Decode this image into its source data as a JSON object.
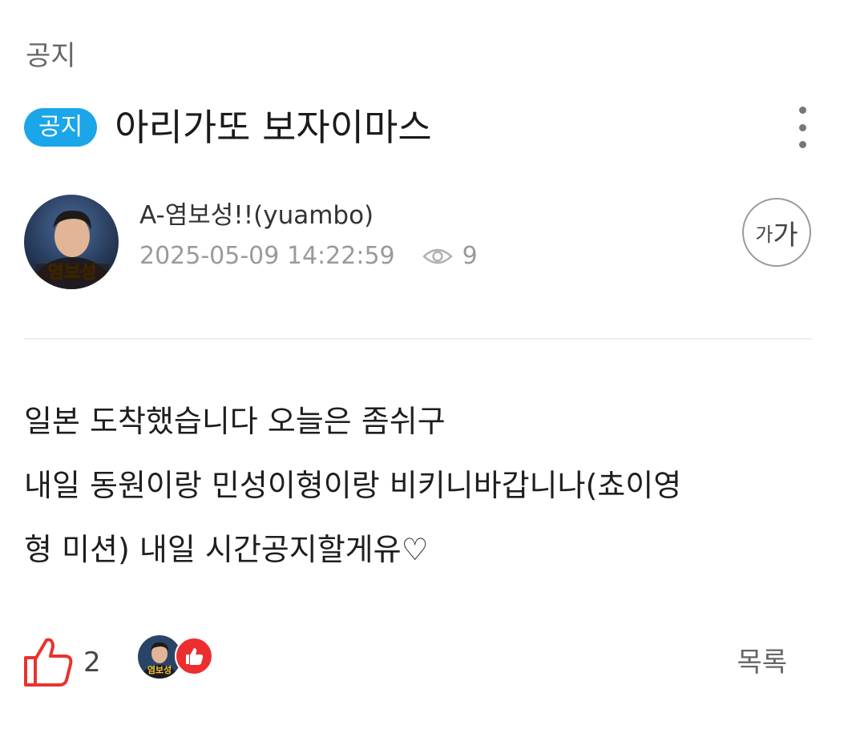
{
  "board": {
    "category": "공지"
  },
  "post": {
    "badge": "공지",
    "title": "아리가또 보자이마스",
    "author": "A-염보성!!(yuambo)",
    "avatar_text": "염보성",
    "datetime": "2025-05-09 14:22:59",
    "views": "9",
    "font_size_small": "가",
    "font_size_big": "가",
    "body_lines": [
      "일본 도착했습니다 오늘은 좀쉬구",
      "내일 동원이랑 민성이형이랑 비키니바갑니나(쵸이영",
      "형 미션) 내일 시간공지할게유♡"
    ]
  },
  "footer": {
    "like_count": "2",
    "liker_avatar_text": "염보성",
    "list_label": "목록"
  },
  "colors": {
    "badge_bg": "#1aa6e8",
    "like_red": "#ec2e2e",
    "meta_gray": "#9a9a9a"
  },
  "icons": {
    "more": "more-vertical-icon",
    "views": "eye-icon",
    "like": "thumbs-up-icon"
  }
}
